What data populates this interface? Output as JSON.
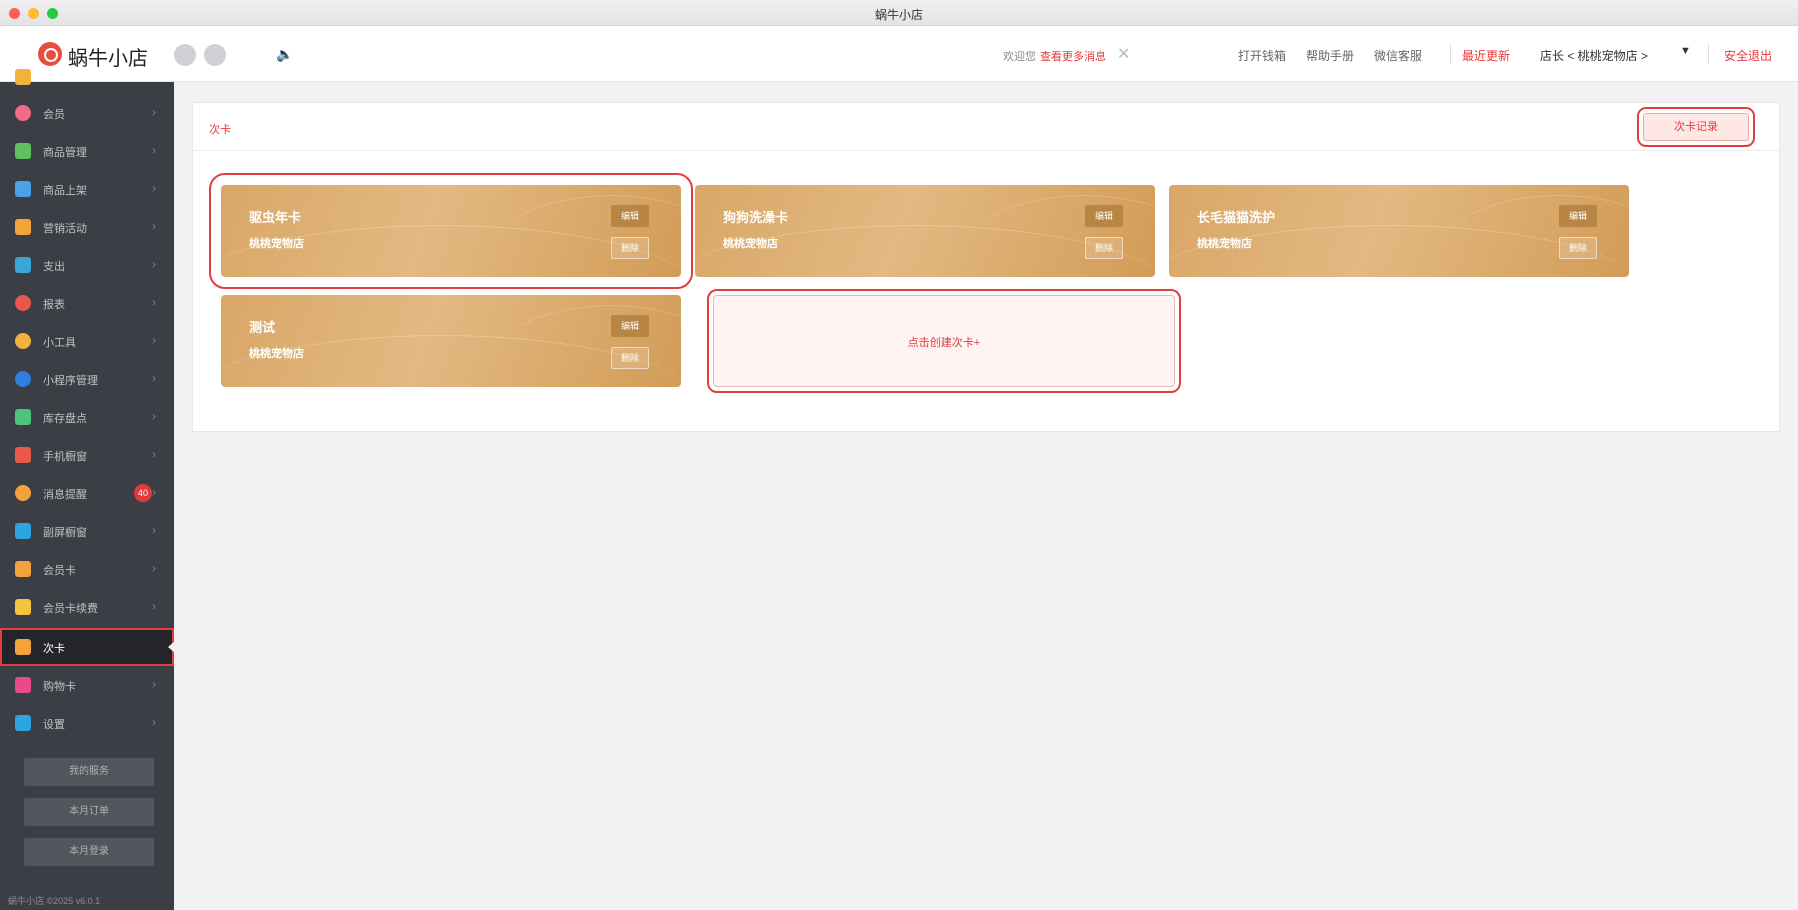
{
  "window": {
    "title": "蜗牛小店"
  },
  "header": {
    "app_name": "蜗牛小店",
    "notice_prefix": "欢迎您",
    "notice_link": "查看更多消息",
    "links": [
      "打开钱箱",
      "帮助手册",
      "微信客服"
    ],
    "recent_update": "最近更新",
    "account": "店长 < 桃桃宠物店 >",
    "logout": "安全退出"
  },
  "sidebar": {
    "items": [
      {
        "label": "会员",
        "icon": "member-icon",
        "color": "#f06a8a"
      },
      {
        "label": "商品管理",
        "icon": "goods-icon",
        "color": "#5fbf5f"
      },
      {
        "label": "商品上架",
        "icon": "shelf-icon",
        "color": "#4aa3e8"
      },
      {
        "label": "营销活动",
        "icon": "marketing-icon",
        "color": "#f2a43a"
      },
      {
        "label": "支出",
        "icon": "expense-icon",
        "color": "#3aa6d8"
      },
      {
        "label": "报表",
        "icon": "report-icon",
        "color": "#e8574a"
      },
      {
        "label": "小工具",
        "icon": "tools-icon",
        "color": "#f2b33d"
      },
      {
        "label": "小程序管理",
        "icon": "miniapp-icon",
        "color": "#2d7fe0"
      },
      {
        "label": "库存盘点",
        "icon": "inventory-icon",
        "color": "#4ec27a"
      },
      {
        "label": "手机橱窗",
        "icon": "phone-icon",
        "color": "#e85a4a"
      },
      {
        "label": "消息提醒",
        "icon": "message-icon",
        "color": "#f2a33c",
        "badge": "40"
      },
      {
        "label": "副屏橱窗",
        "icon": "screen-icon",
        "color": "#2ea5e0"
      },
      {
        "label": "会员卡",
        "icon": "member-card-icon",
        "color": "#f2a33c"
      },
      {
        "label": "会员卡续费",
        "icon": "card-renew-icon",
        "color": "#f2c53d"
      },
      {
        "label": "次卡",
        "icon": "times-card-icon",
        "color": "#f2a33c",
        "active": true
      },
      {
        "label": "购物卡",
        "icon": "shopping-card-icon",
        "color": "#e84a8a"
      },
      {
        "label": "设置",
        "icon": "settings-icon",
        "color": "#2ea5e0"
      }
    ],
    "buttons": [
      "我的服务",
      "本月订单",
      "本月登录"
    ],
    "footer": "蜗牛小店 ©2025 v6.0.1"
  },
  "main": {
    "title": "次卡",
    "record_button": "次卡记录",
    "cards": [
      {
        "name": "驱虫年卡",
        "store": "桃桃宠物店",
        "edit": "编辑",
        "delete": "删除"
      },
      {
        "name": "狗狗洗澡卡",
        "store": "桃桃宠物店",
        "edit": "编辑",
        "delete": "删除"
      },
      {
        "name": "长毛猫猫洗护",
        "store": "桃桃宠物店",
        "edit": "编辑",
        "delete": "删除"
      },
      {
        "name": "测试",
        "store": "桃桃宠物店",
        "edit": "编辑",
        "delete": "删除"
      }
    ],
    "create_label": "点击创建次卡+"
  }
}
